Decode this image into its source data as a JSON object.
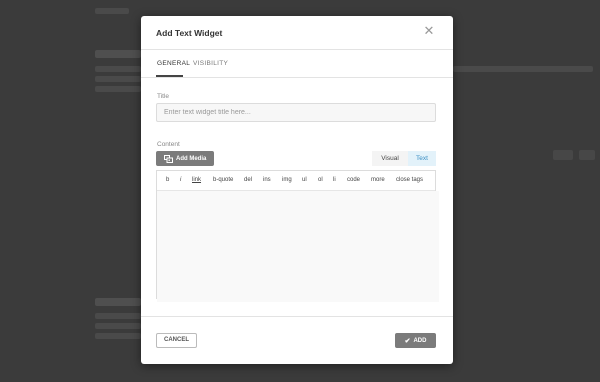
{
  "modal": {
    "title": "Add Text Widget",
    "close_icon": "close-icon",
    "tabs": [
      {
        "label": "GENERAL",
        "active": true
      },
      {
        "label": "VISIBILITY",
        "active": false
      }
    ],
    "title_field": {
      "label": "Title",
      "placeholder": "Enter text widget title here...",
      "value": ""
    },
    "content": {
      "label": "Content",
      "add_media_label": "Add Media",
      "add_media_icon": "media-icon",
      "mode_visual": "Visual",
      "mode_text": "Text",
      "active_mode": "Text",
      "quicktags": [
        "b",
        "i",
        "link",
        "b-quote",
        "del",
        "ins",
        "img",
        "ul",
        "ol",
        "li",
        "code",
        "more",
        "close tags"
      ]
    },
    "footer": {
      "cancel_label": "CANCEL",
      "add_label": "ADD",
      "add_icon": "check-icon"
    }
  },
  "colors": {
    "overlay": "#3b3b3b",
    "primary_button": "#7b7b7b",
    "active_mode_bg": "#e3f2fa",
    "active_mode_text": "#3b8fc4"
  }
}
